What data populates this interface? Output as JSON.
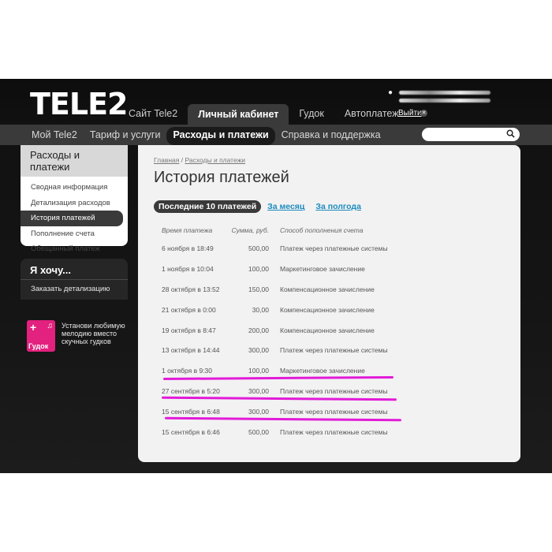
{
  "header": {
    "logo": "TELE2",
    "tabs": [
      {
        "label": "Сайт Tele2"
      },
      {
        "label": "Личный кабинет",
        "active": true
      },
      {
        "label": "Гудок"
      },
      {
        "label": "Автоплатеж"
      }
    ],
    "logout_label": "Выйти"
  },
  "subnav": {
    "items": [
      {
        "label": "Мой Tele2"
      },
      {
        "label": "Тариф и услуги"
      },
      {
        "label": "Расходы и платежи",
        "active": true
      },
      {
        "label": "Справка и поддержка"
      }
    ],
    "search_placeholder": ""
  },
  "sidebar": {
    "title": "Расходы и платежи",
    "items": [
      {
        "label": "Сводная информация"
      },
      {
        "label": "Детализация расходов"
      },
      {
        "label": "История платежей",
        "active": true
      },
      {
        "label": "Пополнение счета"
      },
      {
        "label": "Обещанный платеж"
      }
    ]
  },
  "want": {
    "title": "Я хочу...",
    "link": "Заказать детализацию"
  },
  "promo": {
    "tile_label": "Гудок",
    "text": "Установи любимую мелодию вместо скучных гудков"
  },
  "main": {
    "breadcrumb": {
      "home": "Главная",
      "sep": "/",
      "current": "Расходы и платежи"
    },
    "title": "История платежей",
    "periods": [
      {
        "label": "Последние 10 платежей",
        "active": true
      },
      {
        "label": "За месяц"
      },
      {
        "label": "За полгода"
      }
    ],
    "table": {
      "headers": [
        "Время платежа",
        "Сумма, руб.",
        "Способ пополнения счета"
      ],
      "rows": [
        [
          "6 ноября в 18:49",
          "500,00",
          "Платеж через платежные системы"
        ],
        [
          "1 ноября в 10:04",
          "100,00",
          "Маркетинговое зачисление"
        ],
        [
          "28 октября в 13:52",
          "150,00",
          "Компенсационное зачисление"
        ],
        [
          "21 октября в 0:00",
          "30,00",
          "Компенсационное зачисление"
        ],
        [
          "19 октября в 8:47",
          "200,00",
          "Компенсационное зачисление"
        ],
        [
          "13 октября в 14:44",
          "300,00",
          "Платеж через платежные системы"
        ],
        [
          "1 октября в 9:30",
          "100,00",
          "Маркетинговое зачисление"
        ],
        [
          "27 сентября в 5:20",
          "300,00",
          "Платеж через платежные системы"
        ],
        [
          "15 сентября в 6:48",
          "300,00",
          "Платеж через платежные системы"
        ],
        [
          "15 сентября в 6:46",
          "500,00",
          "Платеж через платежные системы"
        ]
      ]
    }
  },
  "colors": {
    "highlight": "#e21bd8",
    "link": "#1b8bbf",
    "accent_pink": "#e3217e"
  }
}
